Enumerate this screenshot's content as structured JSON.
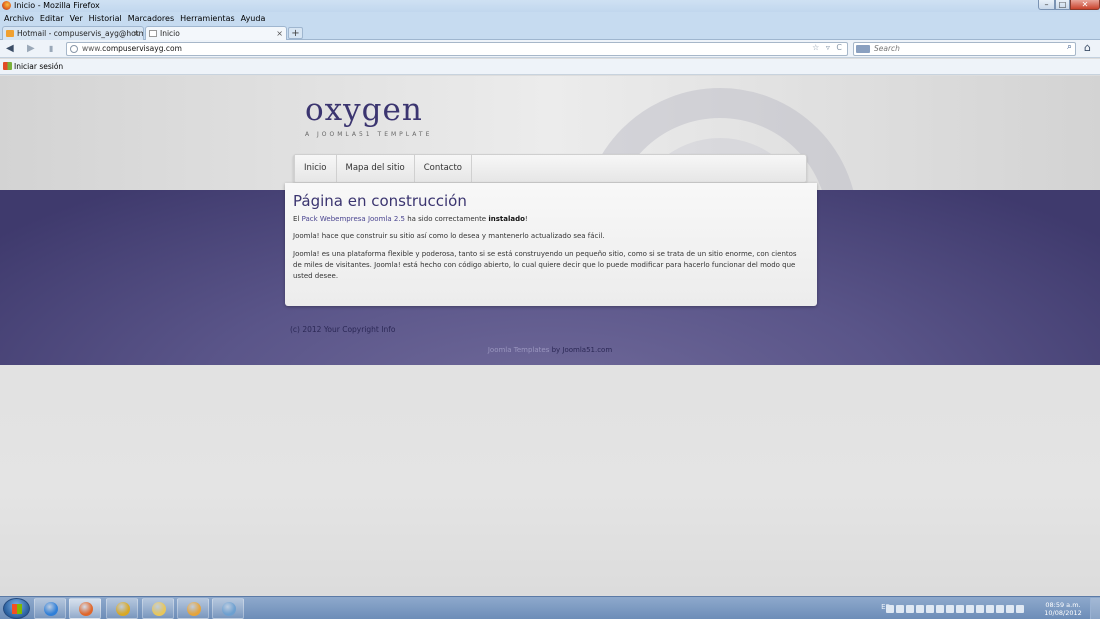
{
  "window": {
    "title": "Inicio - Mozilla Firefox",
    "min": "–",
    "max": "□",
    "close": "✕"
  },
  "menu": [
    "Archivo",
    "Editar",
    "Ver",
    "Historial",
    "Marcadores",
    "Herramientas",
    "Ayuda"
  ],
  "tabs": [
    {
      "label": "Hotmail - compuservis_ayg@hotmail....",
      "icon": "hotmail-icon",
      "close": "×"
    },
    {
      "label": "Inicio",
      "icon": "page-icon",
      "close": "×"
    }
  ],
  "new_tab": "+",
  "nav": {
    "url_prefix": "www.",
    "url_domain": "compuservisayg.com",
    "url_right": "☆ ▿ C",
    "search_placeholder": "Search",
    "back": "◀",
    "forward": "▶",
    "home": "⌂",
    "search_go": "⌕"
  },
  "bookmarks": {
    "label": "Iniciar sesión"
  },
  "page": {
    "logo": "oxygen",
    "tagline": "A JOOMLA51 TEMPLATE",
    "menu": [
      "Inicio",
      "Mapa del sitio",
      "Contacto"
    ],
    "heading": "Página en construcción",
    "p1_pre": "El ",
    "p1_link": "Pack Webempresa Joomla 2.5",
    "p1_mid": " ha sido correctamente ",
    "p1_bold": "instalado",
    "p1_end": "!",
    "p2": "Joomla! hace que construir su sitio así como lo desea y mantenerlo actualizado sea fácil.",
    "p3": "Joomla! es una plataforma flexible y poderosa, tanto si se está construyendo un pequeño sitio, como si se trata de un sitio enorme, con cientos de miles de visitantes. Joomla! está hecho con código abierto, lo cual quiere decir que lo puede modificar para hacerlo funcionar del modo que usted desee.",
    "copyright": "(c) 2012 Your Copyright Info",
    "footer_link": "Joomla Templates",
    "footer_rest": " by Joomla51.com"
  },
  "taskbar": {
    "apps": [
      {
        "name": "internet-explorer-icon",
        "color": "#2f7fd8"
      },
      {
        "name": "firefox-icon",
        "color": "#e0662a"
      },
      {
        "name": "chrome-icon",
        "color": "#d9a823"
      },
      {
        "name": "explorer-folder-icon",
        "color": "#e8c65a"
      },
      {
        "name": "media-player-icon",
        "color": "#e6a43a"
      },
      {
        "name": "network-app-icon",
        "color": "#6da0d0"
      }
    ],
    "lang": "ES",
    "time": "08:59 a.m.",
    "date": "10/08/2012"
  }
}
